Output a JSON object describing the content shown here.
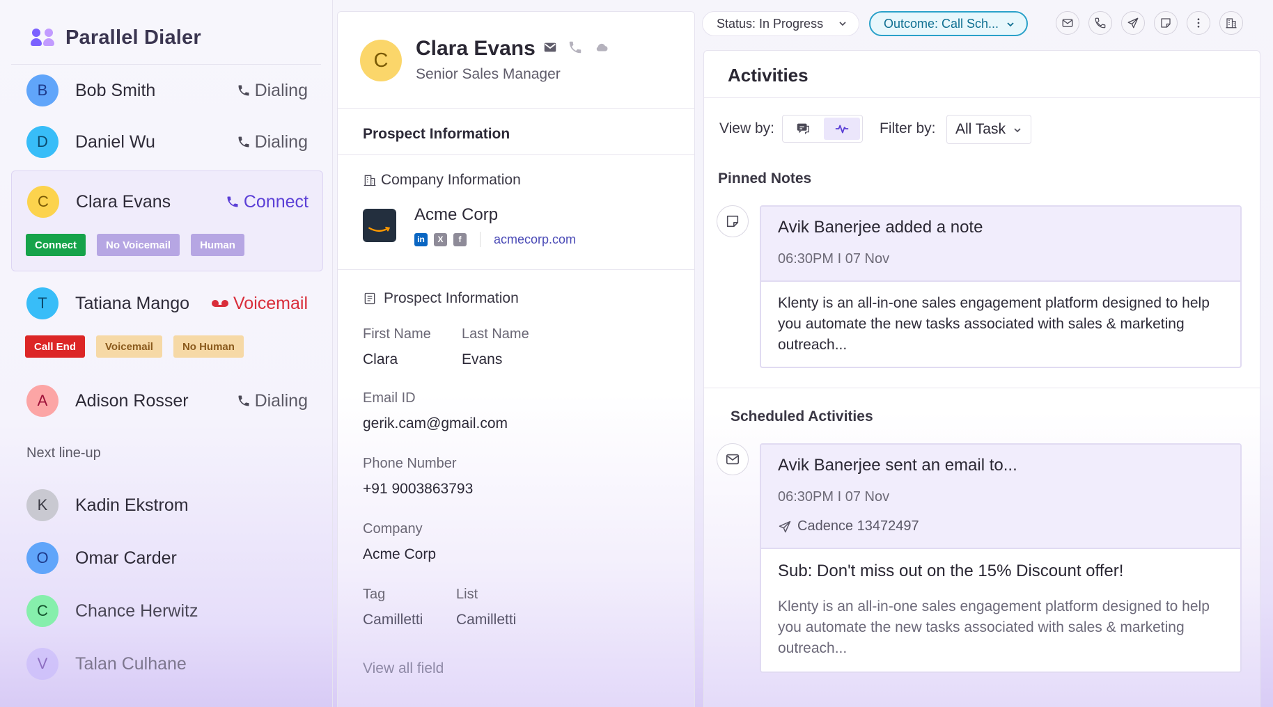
{
  "app": {
    "title": "Parallel Dialer"
  },
  "dialer": {
    "contacts": [
      {
        "initial": "B",
        "name": "Bob Smith",
        "status": "Dialing"
      },
      {
        "initial": "D",
        "name": "Daniel Wu",
        "status": "Dialing"
      },
      {
        "initial": "C",
        "name": "Clara Evans",
        "status": "Connect",
        "tags": [
          "Connect",
          "No Voicemail",
          "Human"
        ]
      },
      {
        "initial": "T",
        "name": "Tatiana Mango",
        "status": "Voicemail",
        "tags": [
          "Call End",
          "Voicemail",
          "No Human"
        ]
      },
      {
        "initial": "A",
        "name": "Adison Rosser",
        "status": "Dialing"
      }
    ],
    "next_lineup_label": "Next line-up",
    "next_lineup": [
      {
        "initial": "K",
        "name": "Kadin Ekstrom"
      },
      {
        "initial": "O",
        "name": "Omar Carder"
      },
      {
        "initial": "C",
        "name": "Chance Herwitz"
      },
      {
        "initial": "V",
        "name": "Talan Culhane"
      }
    ]
  },
  "profile": {
    "initial": "C",
    "name": "Clara Evans",
    "title": "Senior Sales Manager",
    "icons": [
      "email-icon",
      "phone-icon",
      "cloud-icon"
    ]
  },
  "prospect": {
    "section_title": "Prospect Information",
    "company_section": "Company Information",
    "company_name": "Acme Corp",
    "company_url": "acmecorp.com",
    "social": [
      "linkedin-icon",
      "x-icon",
      "facebook-icon"
    ],
    "info_title": "Prospect Information",
    "first_name_label": "First Name",
    "first_name": "Clara",
    "last_name_label": "Last Name",
    "last_name": "Evans",
    "email_label": "Email ID",
    "email": "gerik.cam@gmail.com",
    "phone_label": "Phone Number",
    "phone": "+91 9003863793",
    "company_label": "Company",
    "company": "Acme Corp",
    "tag_label": "Tag",
    "tag": "Camilletti",
    "list_label": "List",
    "list": "Camilletti",
    "view_all": "View all field"
  },
  "toolbar": {
    "status": "Status: In Progress",
    "outcome": "Outcome: Call Sch...",
    "icons": [
      "email-icon",
      "phone-icon",
      "send-icon",
      "note-icon",
      "more-icon",
      "building-icon"
    ]
  },
  "activities": {
    "title": "Activities",
    "view_by_label": "View by:",
    "filter_by_label": "Filter by:",
    "filter_value": "All Task",
    "pinned_title": "Pinned Notes",
    "pinned_note": {
      "heading": "Avik Banerjee added a note",
      "time": "06:30PM I 07 Nov",
      "body": "Klenty is an all-in-one sales engagement platform designed to help you automate the new tasks associated with sales & marketing outreach..."
    },
    "scheduled_title": "Scheduled Activities",
    "scheduled_item": {
      "heading": "Avik Banerjee sent an email to...",
      "time": "06:30PM I 07 Nov",
      "cadence": "Cadence 13472497",
      "subject": "Sub: Don't miss out on the 15% Discount offer!",
      "body": "Klenty is an all-in-one sales engagement platform designed to help you automate the new tasks associated with sales & marketing outreach..."
    }
  },
  "colors": {
    "accent": "#5b3fd6",
    "connect_green": "#16a34a",
    "call_end_red": "#dc2626",
    "voicemail_red": "#d92d3a",
    "outcome_blue": "#2aa1c9"
  }
}
